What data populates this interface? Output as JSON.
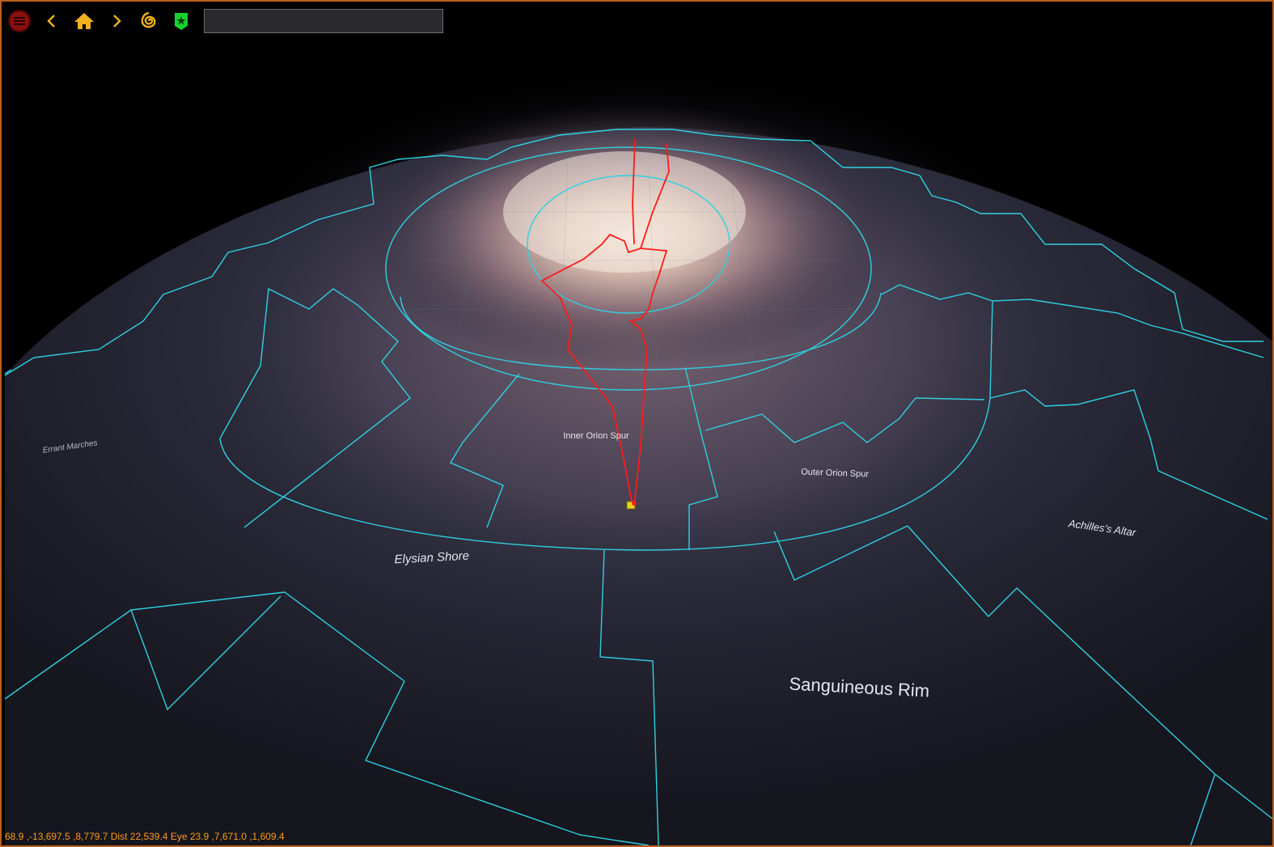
{
  "toolbar": {
    "menu_icon": "hamburger-menu-icon",
    "back_icon": "chevron-left-icon",
    "home_icon": "home-icon",
    "forward_icon": "chevron-right-icon",
    "galaxy_icon": "galaxy-spiral-icon",
    "bookmark_icon": "star-badge-icon",
    "search_value": ""
  },
  "colors": {
    "frame_border": "#b8601e",
    "region_outline": "#2fd0e0",
    "route": "#ff1a1a",
    "status_text": "#ff9a1a",
    "menu_button": "#8a1010",
    "home_icon": "#f0b020",
    "bookmark_icon": "#18d030"
  },
  "regions": {
    "inner_orion_spur": "Inner Orion Spur",
    "outer_orion_spur": "Outer Orion Spur",
    "elysian_shore": "Elysian Shore",
    "achilless_altar": "Achilles's Altar",
    "sanguineous_rim": "Sanguineous Rim",
    "errant_marches": "Errant Marches"
  },
  "status": {
    "text": "68.9 ,-13,697.5 ,8,779.7 Dist 22,539.4 Eye 23.9 ,7,671.0 ,1,609.4"
  }
}
